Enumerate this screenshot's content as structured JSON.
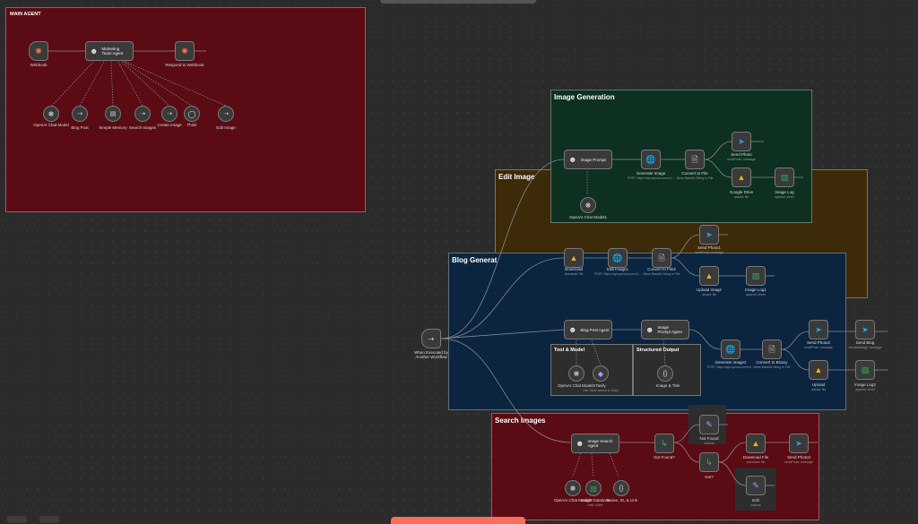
{
  "canvas": {
    "background": "#2b2b2b",
    "sticky_notes": {
      "main_agent": {
        "title": "MAIN AGENT",
        "color": "#5a0b14"
      },
      "image_generation": {
        "title": "Image Generation",
        "color": "#0d3020"
      },
      "edit_image": {
        "title": "Edit Image",
        "color": "#3d2a08"
      },
      "blog_generation": {
        "title": "Blog Generat",
        "color": "#0b2440"
      },
      "tool_model": {
        "title": "Tool & Model"
      },
      "structured_output": {
        "title": "Structured Output"
      },
      "search_images": {
        "title": "Search Images",
        "color": "#5a0b14"
      }
    }
  },
  "nodes": {
    "webhook": {
      "label": "Webhook",
      "icon": "webhook-icon"
    },
    "marketing_team_agent": {
      "label": "Marketing Team Agent",
      "icon": "robot-icon"
    },
    "respond_to_webhook": {
      "label": "Respond to Webhook",
      "icon": "webhook-icon"
    },
    "openai_chat_model": {
      "label": "OpenAI Chat Model",
      "icon": "openai-icon"
    },
    "blog_post": {
      "label": "Blog Post",
      "icon": "workflow-icon"
    },
    "simple_memory": {
      "label": "Simple Memory",
      "icon": "memory-icon"
    },
    "search_images_tool": {
      "label": "Search Images",
      "icon": "workflow-icon"
    },
    "create_image": {
      "label": "Create Image",
      "icon": "workflow-icon"
    },
    "think": {
      "label": "Think",
      "icon": "think-icon"
    },
    "edit_image_tool": {
      "label": "Edit Image",
      "icon": "workflow-icon"
    },
    "image_prompt": {
      "label": "Image Prompt",
      "icon": "robot-icon"
    },
    "openai_chat_model1": {
      "label": "OpenAI Chat Model1",
      "icon": "openai-icon"
    },
    "generate_image": {
      "label": "Generate Image",
      "sub": "POST: https://api.openai.com/v1/...",
      "icon": "globe-icon"
    },
    "convert_to_file": {
      "label": "Convert to File",
      "sub": "Move Base64 String to File",
      "icon": "file-icon"
    },
    "send_photo": {
      "label": "Send Photo",
      "sub": "sendPhoto: message",
      "icon": "telegram-icon"
    },
    "google_drive": {
      "label": "Google Drive",
      "sub": "upload: file",
      "icon": "drive-icon"
    },
    "image_log": {
      "label": "Image Log",
      "sub": "append: sheet",
      "icon": "sheets-icon"
    },
    "download": {
      "label": "Download",
      "sub": "download: file",
      "icon": "drive-icon"
    },
    "edit_image1": {
      "label": "Edit Image1",
      "sub": "POST: https://api.openai.com/v1/...",
      "icon": "globe-icon"
    },
    "convert_to_file2": {
      "label": "Convert to File2",
      "sub": "Move Base64 String to File",
      "icon": "file-icon"
    },
    "send_photo1": {
      "label": "Send Photo1",
      "sub": "sendPhoto: message",
      "icon": "telegram-icon"
    },
    "upload_image": {
      "label": "Upload Image",
      "sub": "upload: file",
      "icon": "drive-icon"
    },
    "image_log1": {
      "label": "Image Log1",
      "sub": "append: sheet",
      "icon": "sheets-icon"
    },
    "when_executed": {
      "label": "When Executed by Another Workflow",
      "icon": "trigger-icon"
    },
    "blog_post_agent": {
      "label": "Blog Post Agent",
      "icon": "robot-icon"
    },
    "image_prompt_agent": {
      "label": "Image Prompt Agent",
      "icon": "robot-icon"
    },
    "openai_chat_model2": {
      "label": "OpenAI Chat Model2",
      "icon": "openai-icon"
    },
    "tavily": {
      "label": "Tavily",
      "sub": "Use Tavily search in Tavily",
      "icon": "tavily-icon"
    },
    "image_title": {
      "label": "Image & Title",
      "icon": "braces-icon"
    },
    "generate_image2": {
      "label": "Generate Image2",
      "sub": "POST: https://api.openai.com/v1/...",
      "icon": "globe-icon"
    },
    "convert_to_binary": {
      "label": "Convert to Binary",
      "sub": "Move Base64 String to File",
      "icon": "file-icon"
    },
    "send_photo2": {
      "label": "Send Photo2",
      "sub": "sendPhoto: message",
      "icon": "telegram-icon"
    },
    "send_blog": {
      "label": "Send Blog",
      "sub": "sendMessage: message",
      "icon": "telegram-icon"
    },
    "upload": {
      "label": "Upload",
      "sub": "upload: file",
      "icon": "drive-icon"
    },
    "image_log2": {
      "label": "Image Log2",
      "sub": "append: sheet",
      "icon": "sheets-icon"
    },
    "image_search_agent": {
      "label": "Image Search Agent",
      "icon": "robot-icon"
    },
    "openai_chat_model3": {
      "label": "OpenAI Chat Model3",
      "icon": "openai-icon"
    },
    "image_database": {
      "label": "Image Database",
      "sub": "read: sheet",
      "icon": "sheets-icon"
    },
    "name_id_link": {
      "label": "Name, ID, & Link",
      "icon": "braces-icon"
    },
    "not_found": {
      "label": "Not Found?",
      "icon": "if-icon"
    },
    "not_found_msg": {
      "label": "Not Found",
      "sub": "manual",
      "icon": "edit-icon"
    },
    "get": {
      "label": "Get?",
      "icon": "if-icon"
    },
    "download_file": {
      "label": "Download File",
      "sub": "download: file",
      "icon": "drive-icon"
    },
    "send_photo3": {
      "label": "Send Photo3",
      "sub": "sendPhoto: message",
      "icon": "telegram-icon"
    },
    "edit": {
      "label": "Edit",
      "sub": "manual",
      "icon": "edit-icon"
    }
  },
  "colors": {
    "node_border": "#7a7a7a",
    "edge": "#8a8a8a",
    "execute_button": "#ff6d5a"
  }
}
